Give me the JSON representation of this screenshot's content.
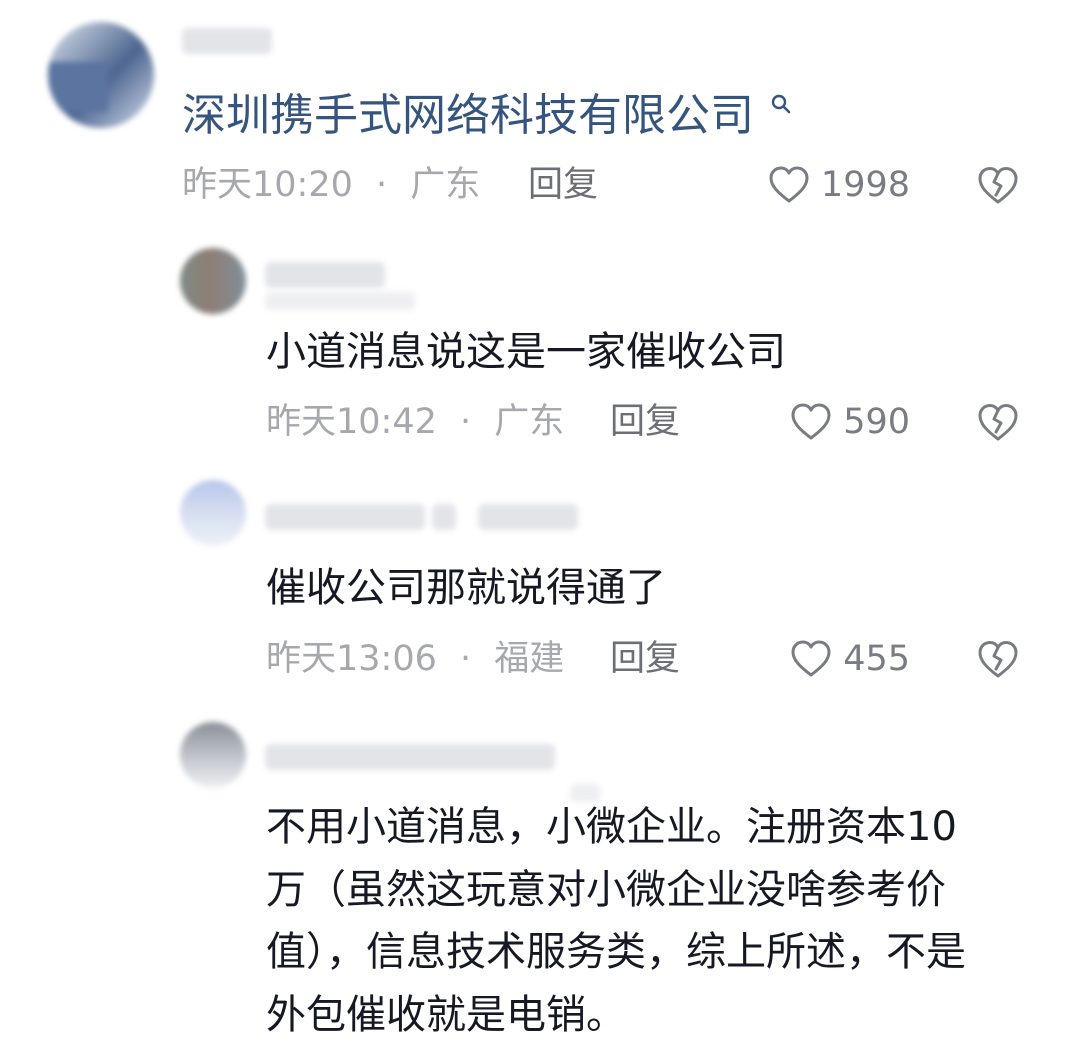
{
  "colors": {
    "link": "#35557f",
    "meta": "#a6a8ad",
    "reply": "#6d6f76",
    "text": "#161823"
  },
  "main_comment": {
    "avatar": "avatar-pixelated",
    "link_text": "深圳携手式网络科技有限公司",
    "link_icon": "search-icon",
    "time": "昨天10:20",
    "separator": "·",
    "location": "广东",
    "reply_label": "回复",
    "likes": "1998"
  },
  "replies": [
    {
      "avatar": "avatar-pixelated",
      "text": "小道消息说这是一家催收公司",
      "time": "昨天10:42",
      "separator": "·",
      "location": "广东",
      "reply_label": "回复",
      "likes": "590"
    },
    {
      "avatar": "avatar-pixelated",
      "text": "催收公司那就说得通了",
      "time": "昨天13:06",
      "separator": "·",
      "location": "福建",
      "reply_label": "回复",
      "likes": "455"
    },
    {
      "avatar": "avatar-pixelated",
      "text": "不用小道消息，小微企业。注册资本10万（虽然这玩意对小微企业没啥参考价值），信息技术服务类，综上所述，不是外包催收就是电销。"
    }
  ]
}
